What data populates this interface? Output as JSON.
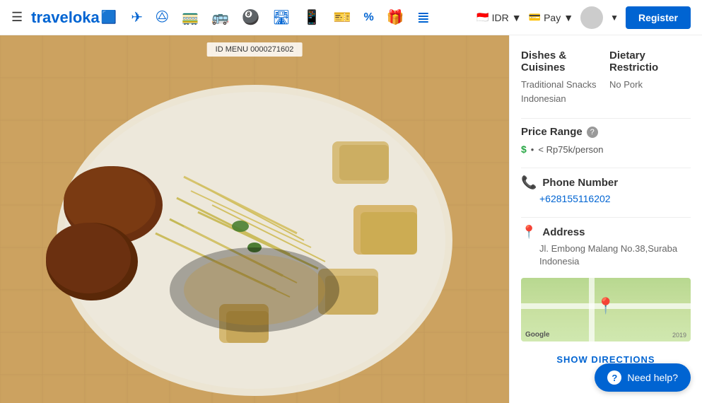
{
  "navbar": {
    "logo_text": "traveloka",
    "menu_icon": "☰",
    "icons": [
      {
        "name": "flight-icon",
        "symbol": "✈",
        "label": "Flights"
      },
      {
        "name": "hotel-icon",
        "symbol": "🏨",
        "label": "Hotels"
      },
      {
        "name": "train-icon",
        "symbol": "🚂",
        "label": "Trains"
      },
      {
        "name": "bus-icon",
        "symbol": "🚌",
        "label": "Bus"
      },
      {
        "name": "activity-icon",
        "symbol": "🎡",
        "label": "Activities"
      },
      {
        "name": "airport-icon",
        "symbol": "🛫",
        "label": "Airport"
      },
      {
        "name": "sim-icon",
        "symbol": "📶",
        "label": "SIM"
      },
      {
        "name": "ticket-icon",
        "symbol": "🎫",
        "label": "Tickets"
      },
      {
        "name": "promo-icon",
        "symbol": "%",
        "label": "Promo"
      },
      {
        "name": "gift-icon",
        "symbol": "🎁",
        "label": "Gift"
      },
      {
        "name": "more-icon",
        "symbol": "≡",
        "label": "More"
      }
    ],
    "currency_label": "IDR",
    "pay_label": "Pay",
    "register_label": "Register"
  },
  "food_image": {
    "menu_id_text": "ID MENU 0000271602"
  },
  "info_panel": {
    "dishes_title": "Dishes &",
    "dishes_title2": "Cuisines",
    "dishes_value1": "Traditional Snacks",
    "dishes_value2": "Indonesian",
    "dietary_title": "Dietary Restrictio",
    "dietary_value": "No Pork",
    "price_range_title": "Price Range",
    "price_range_dollar": "$",
    "price_range_bullet": "•",
    "price_range_value": "< Rp75k/person",
    "phone_title": "Phone Number",
    "phone_number": "+628155116202",
    "address_title": "Address",
    "address_value": "Jl. Embong Malang No.38,Suraba Indonesia",
    "show_directions_label": "SHOW DIRECTIONS",
    "map_google_logo": "Google",
    "map_year": "2019"
  },
  "help_button": {
    "label": "Need help?"
  }
}
